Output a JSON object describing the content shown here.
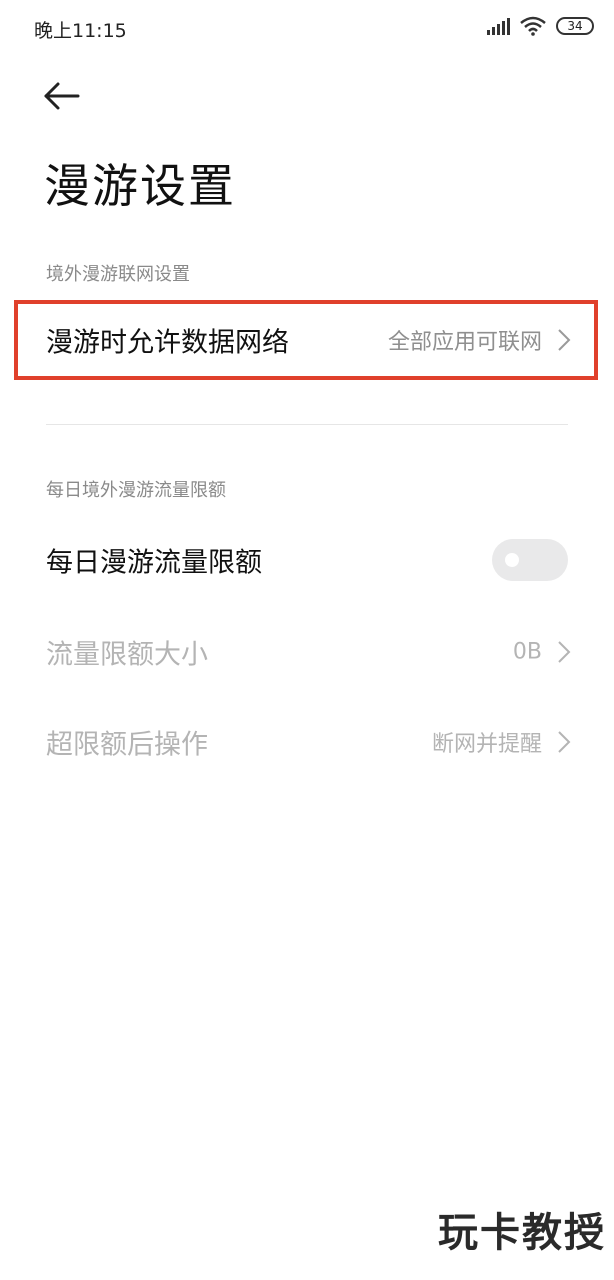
{
  "status_bar": {
    "time": "晚上11:15",
    "battery": "34",
    "icons": [
      "signal-icon",
      "wifi-icon",
      "battery-icon"
    ]
  },
  "header": {
    "back_icon": "arrow-left-icon",
    "title": "漫游设置"
  },
  "sections": {
    "roaming_network": {
      "header": "境外漫游联网设置",
      "row": {
        "label": "漫游时允许数据网络",
        "value": "全部应用可联网"
      }
    },
    "daily_limit": {
      "header": "每日境外漫游流量限额",
      "toggle_row": {
        "label": "每日漫游流量限额",
        "enabled": false
      },
      "limit_row": {
        "label": "流量限额大小",
        "value": "0B"
      },
      "action_row": {
        "label": "超限额后操作",
        "value": "断网并提醒"
      }
    }
  },
  "highlight_color": "#e0402b",
  "watermark": "玩卡教授"
}
